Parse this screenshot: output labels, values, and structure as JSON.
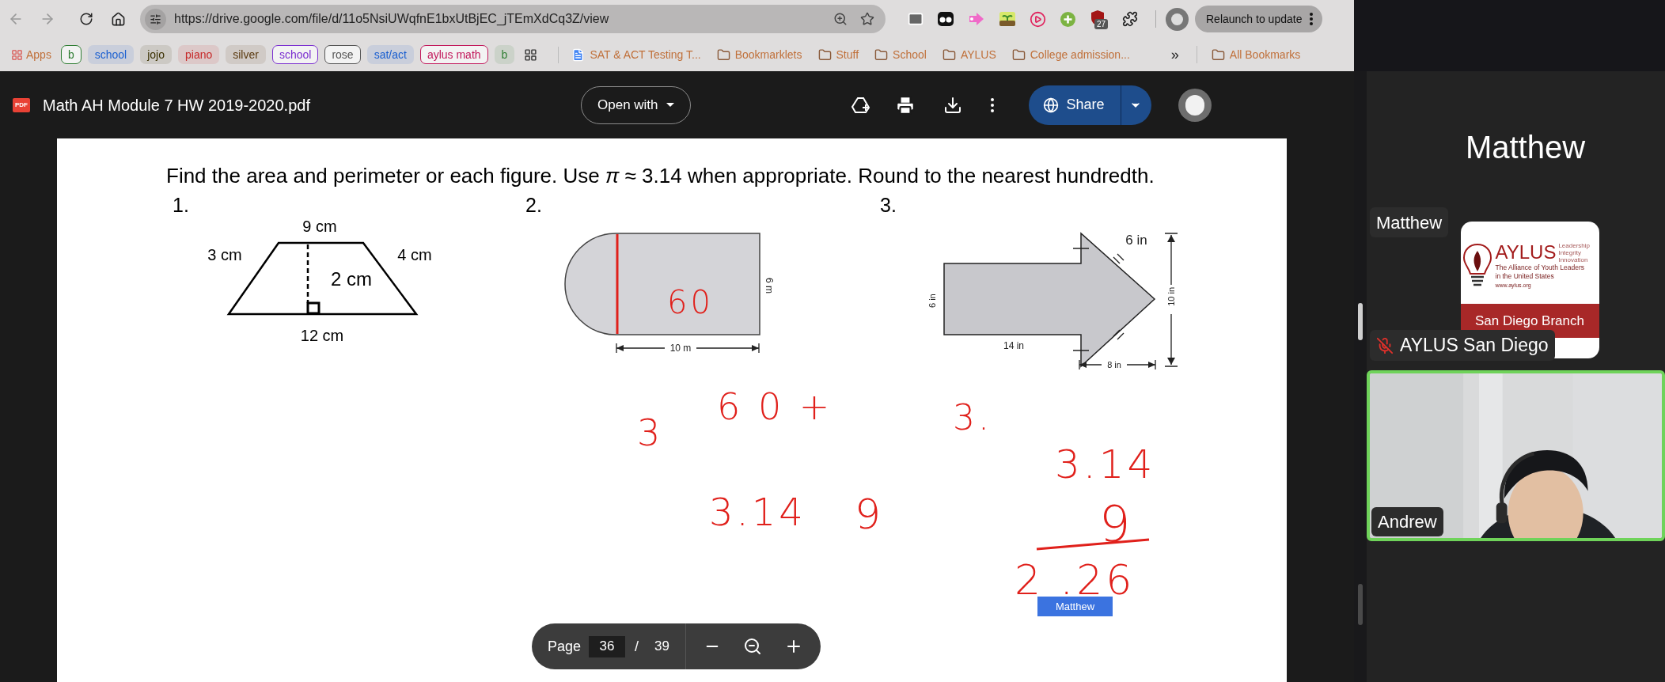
{
  "browser": {
    "url": "https://drive.google.com/file/d/11o5NsiUWqfnE1bxUtBjEC_jTEmXdCq3Z/view",
    "extension_badge": "27",
    "relaunch_button": "Relaunch to update",
    "bookmarks": [
      {
        "kind": "apps",
        "label": "Apps"
      },
      {
        "kind": "chip",
        "label": "b",
        "color": "#2e7d32",
        "outlined": true
      },
      {
        "kind": "chip",
        "label": "school",
        "color": "#1a5fd0",
        "outlined": false
      },
      {
        "kind": "chip",
        "label": "jojo",
        "color": "#3a3000",
        "outlined": false
      },
      {
        "kind": "chip",
        "label": "piano",
        "color": "#c62828",
        "outlined": false
      },
      {
        "kind": "chip",
        "label": "silver",
        "color": "#5a3a10",
        "outlined": false
      },
      {
        "kind": "chip",
        "label": "school",
        "color": "#7b2fd0",
        "outlined": true
      },
      {
        "kind": "chip",
        "label": "rose",
        "color": "#555555",
        "outlined": true
      },
      {
        "kind": "chip",
        "label": "sat/act",
        "color": "#1a5fd0",
        "outlined": false
      },
      {
        "kind": "chip",
        "label": "aylus math",
        "color": "#c2185b",
        "outlined": true
      },
      {
        "kind": "chip",
        "label": "b",
        "color": "#2e7d32",
        "outlined": false
      },
      {
        "kind": "grid"
      },
      {
        "kind": "doc",
        "label": "SAT & ACT Testing T..."
      },
      {
        "kind": "folder",
        "label": "Bookmarklets"
      },
      {
        "kind": "folder",
        "label": "Stuff"
      },
      {
        "kind": "folder",
        "label": "School"
      },
      {
        "kind": "folder",
        "label": "AYLUS"
      },
      {
        "kind": "folder",
        "label": "College admission..."
      }
    ],
    "overflow": "»",
    "all_bookmarks": "All Bookmarks"
  },
  "viewer": {
    "file_badge": "PDF",
    "file_title": "Math AH Module 7 HW 2019-2020.pdf",
    "open_with": "Open with",
    "share": "Share"
  },
  "document": {
    "instructions": "Find the area and perimeter or each figure. Use *π* ≈ 3.14 when appropriate.  Round to the nearest hundredth.",
    "problems": [
      {
        "number": "1.",
        "labels": [
          "9 cm",
          "3 cm",
          "4 cm",
          "2 cm",
          "12 cm"
        ]
      },
      {
        "number": "2.",
        "labels": [
          "6 m",
          "10 m"
        ]
      },
      {
        "number": "3.",
        "labels": [
          "6 in",
          "6 in",
          "14 in",
          "8 in",
          "10 in"
        ]
      }
    ],
    "ink": [
      "60",
      "6 0 +",
      "3",
      "3.",
      "3.14",
      "3.14",
      "9",
      "9",
      "2 .26"
    ],
    "cursor_label": "Matthew"
  },
  "page_controls": {
    "label": "Page",
    "current": "36",
    "separator": "/",
    "total": "39"
  },
  "call": {
    "speaker_name": "Matthew",
    "speaker_tag": "Matthew",
    "tiles": [
      {
        "kind": "logo",
        "name": "AYLUS San Diego",
        "muted": true,
        "logo": {
          "title": "AYLUS",
          "motto": [
            "Leadership",
            "Integrity",
            "Innovation"
          ],
          "subtitle": [
            "The Alliance of Youth Leaders",
            "in the United States"
          ],
          "website": "www.aylus.org",
          "branch": "San Diego Branch"
        }
      },
      {
        "kind": "video",
        "name": "Andrew",
        "speaking": true
      }
    ]
  }
}
